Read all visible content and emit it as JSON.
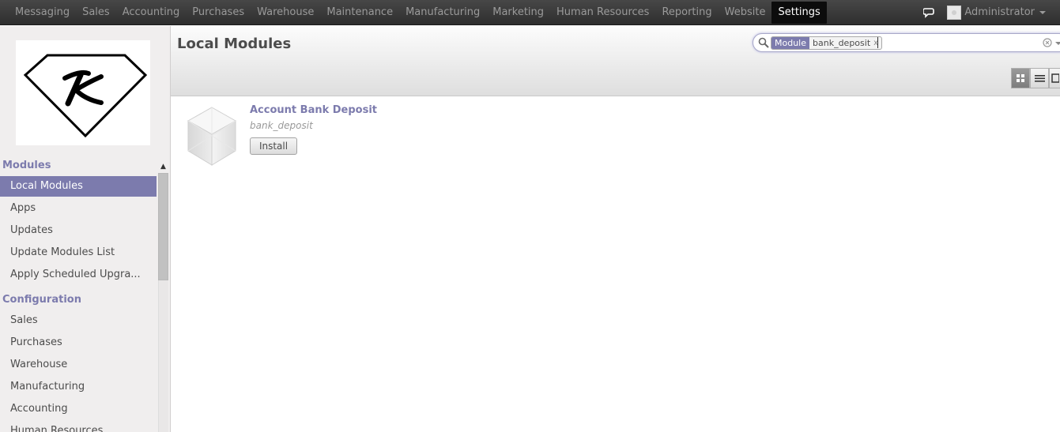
{
  "topbar": {
    "menu": [
      "Messaging",
      "Sales",
      "Accounting",
      "Purchases",
      "Warehouse",
      "Maintenance",
      "Manufacturing",
      "Marketing",
      "Human Resources",
      "Reporting",
      "Website",
      "Settings"
    ],
    "active": "Settings",
    "user": "Administrator"
  },
  "sidebar": {
    "modules_head": "Modules",
    "modules": [
      "Local Modules",
      "Apps",
      "Updates",
      "Update Modules List",
      "Apply Scheduled Upgra..."
    ],
    "active": "Local Modules",
    "config_head": "Configuration",
    "config": [
      "Sales",
      "Purchases",
      "Warehouse",
      "Manufacturing",
      "Accounting",
      "Human Resources"
    ]
  },
  "main": {
    "title": "Local Modules",
    "search": {
      "facet_category": "Module",
      "facet_value": "bank_deposit",
      "facet_remove": "x",
      "query": ""
    },
    "modules": [
      {
        "name": "Account Bank Deposit",
        "technical_name": "bank_deposit",
        "button": "Install"
      }
    ]
  },
  "colors": {
    "accent": "#7c7bad",
    "topbar": "#414141",
    "sidebar": "#f0eeee"
  },
  "icons": [
    "chat-icon",
    "search-icon",
    "clear-search-icon",
    "kanban-view-icon",
    "list-view-icon",
    "form-view-icon",
    "module-icon"
  ]
}
